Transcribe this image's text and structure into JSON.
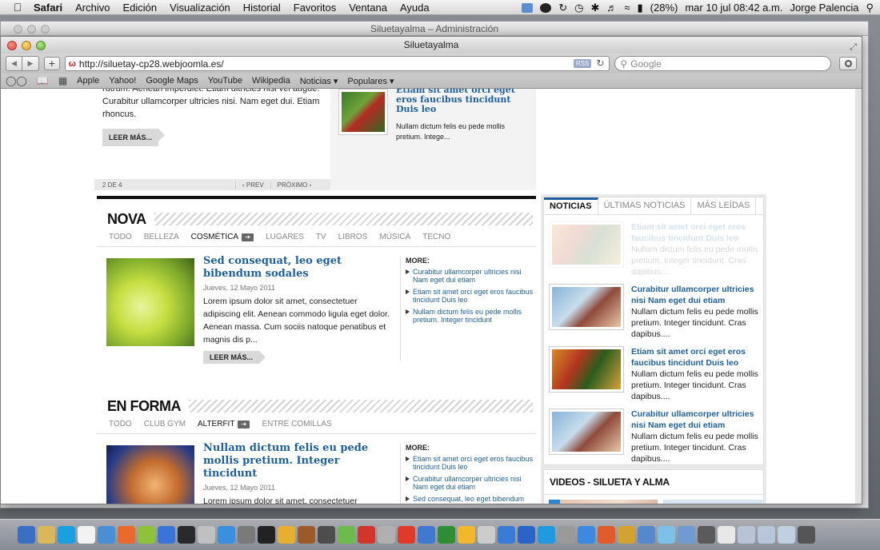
{
  "menubar": {
    "app": "Safari",
    "items": [
      "Archivo",
      "Edición",
      "Visualización",
      "Historial",
      "Favoritos",
      "Ventana",
      "Ayuda"
    ],
    "battery": "(28%)",
    "datetime": "mar 10 jul  08:42 a.m.",
    "user": "Jorge Palencia"
  },
  "back_window": {
    "title": "Siluetayalma – Administración"
  },
  "window": {
    "title": "Siluetayalma"
  },
  "toolbar": {
    "url": "http://siluetay-cp28.webjoomla.es/",
    "rss": "RSS",
    "search_placeholder": "Google"
  },
  "bookmarks": [
    "Apple",
    "Yahoo!",
    "Google Maps",
    "YouTube",
    "Wikipedia",
    "Noticias ▾",
    "Populares ▾"
  ],
  "slider": {
    "text": "rutrum. Aenean imperdiet. Etiam ultricies nisi vel augue. Curabitur ullamcorper ultricies nisi. Nam eget dui. Etiam rhoncus.",
    "read_more": "LEER MÁS...",
    "counter": "2 DE 4",
    "prev": "‹ PREV",
    "next": "PRÓXIMO ›",
    "side_title": "Etiam sit amet orci eget eros faucibus tincidunt Duis leo",
    "side_text": "Nullam dictum felis eu pede mollis pretium. Intege..."
  },
  "nova": {
    "heading": "NOVA",
    "tabs": [
      "TODO",
      "BELLEZA",
      "COSMÉTICA",
      "LUGARES",
      "TV",
      "LIBROS",
      "MÚSICA",
      "TECNO"
    ],
    "active_tab": "COSMÉTICA",
    "title": "Sed consequat, leo eget bibendum sodales",
    "date": "Jueves, 12 Mayo 2011",
    "text": "Lorem ipsum dolor sit amet, consectetuer adipiscing elit. Aenean commodo ligula eget dolor. Aenean massa. Cum sociis natoque penatibus et magnis dis p...",
    "read_more": "LEER MÁS...",
    "more_label": "MORE:",
    "more": [
      "Curabitur ullamcorper ultricies nisi Nam eget dui etiam",
      "Etiam sit amet orci eget eros faucibus tincidunt Duis leo",
      "Nullam dictum felis eu pede mollis pretium. Integer tincidunt"
    ]
  },
  "enforma": {
    "heading": "EN FORMA",
    "tabs": [
      "TODO",
      "CLUB GYM",
      "ALTERFIT",
      "ENTRE COMILLAS"
    ],
    "active_tab": "ALTERFIT",
    "title": "Nullam dictum felis eu pede mollis pretium. Integer tincidunt",
    "date": "Jueves, 12 Mayo 2011",
    "text": "Lorem ipsum dolor sit amet, consectetuer adipiscing elit. Aenean commodo ligula eget dolor. Aenean massa. Cum sociis natoque penatibus et magnis dis p...",
    "more_label": "MORE:",
    "more": [
      "Etiam sit amet orci eget eros faucibus tincidunt Duis leo",
      "Curabitur ullamcorper ultricies nisi Nam eget dui etiam",
      "Sed consequat, leo eget bibendum sodales"
    ]
  },
  "news": {
    "tabs": [
      "NOTICIAS",
      "ÚLTIMAS NOTICIAS",
      "MÁS LEÍDAS"
    ],
    "items": [
      {
        "title": "Etiam sit amet orci eget eros faucibus tincidunt Duis leo",
        "text": "Nullam dictum felis eu pede mollis pretium. Integer tincidunt. Cras dapibus...."
      },
      {
        "title": "Curabitur ullamcorper ultricies nisi Nam eget dui etiam",
        "text": "Nullam dictum felis eu pede mollis pretium. Integer tincidunt. Cras dapibus...."
      },
      {
        "title": "Etiam sit amet orci eget eros faucibus tincidunt Duis leo",
        "text": "Nullam dictum felis eu pede mollis pretium. Integer tincidunt. Cras dapibus...."
      },
      {
        "title": "Curabitur ullamcorper ultricies nisi Nam eget dui etiam",
        "text": "Nullam dictum felis eu pede mollis pretium. Integer tincidunt. Cras dapibus...."
      }
    ]
  },
  "videos": {
    "heading": "VIDEOS - SILUETA Y ALMA"
  },
  "dock_colors": [
    "#3a6fc4",
    "#d8b85a",
    "#1aa0e0",
    "#f2f2f2",
    "#4a8fd6",
    "#e96a2a",
    "#8fc23a",
    "#3b74d8",
    "#2a2a2a",
    "#c0c0c0",
    "#3b8fe0",
    "#7a7a7a",
    "#222",
    "#e7ae30",
    "#9c5a2a",
    "#4d4d4d",
    "#6dbb4c",
    "#d2362a",
    "#b0b0b0",
    "#e03a2a",
    "#3f7ad0",
    "#2f8d36",
    "#f2b72a",
    "#cccccc",
    "#3a7bd5",
    "#2a64c8",
    "#1f9ae0",
    "#9a9a9a",
    "#3b8ae0",
    "#e25b2a",
    "#d4a230",
    "#5588cc",
    "#7dc0e8",
    "#6f9bd0",
    "#5a5a5a",
    "#e8e8e8",
    "#b7c4d6",
    "#b8c6d9",
    "#c2cfdf",
    "#555"
  ]
}
